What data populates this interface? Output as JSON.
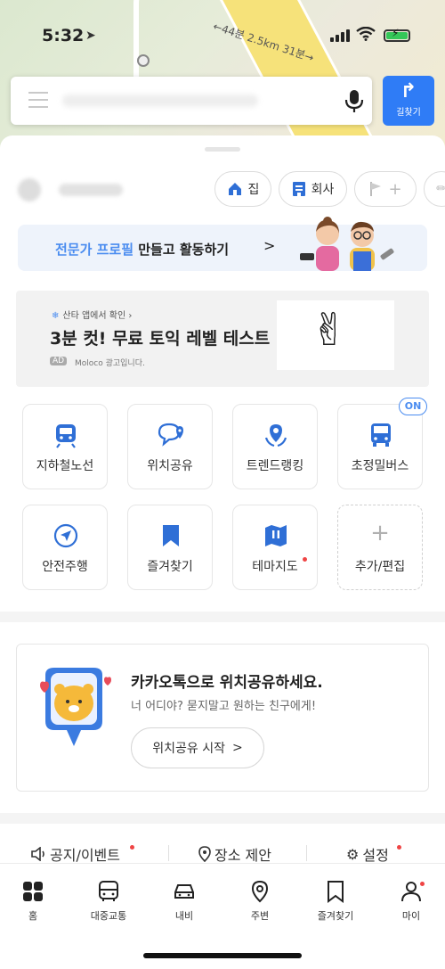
{
  "status_bar": {
    "time": "5:32"
  },
  "map": {
    "distance_label": "←44분 2.5km 31분→"
  },
  "search": {
    "route_button_label": "길찾기"
  },
  "shortcuts": [
    {
      "label": "집",
      "icon": "home-icon"
    },
    {
      "label": "회사",
      "icon": "office-icon"
    },
    {
      "label": "+",
      "icon": "flag-icon"
    }
  ],
  "banner": {
    "highlight": "전문가 프로필",
    "rest": " 만들고 활동하기",
    "chevron": ">"
  },
  "ad": {
    "source": "산타 앱에서 확인 ›",
    "headline": "3분 컷! 무료 토익 레벨 테스트",
    "badge": "AD",
    "advertiser": "Moloco 광고입니다."
  },
  "tiles_row1": [
    {
      "label": "지하철노선",
      "icon": "subway-icon"
    },
    {
      "label": "위치공유",
      "icon": "location-share-icon"
    },
    {
      "label": "트렌드랭킹",
      "icon": "trend-ranking-icon"
    },
    {
      "label": "초정밀버스",
      "icon": "bus-icon",
      "badge": "ON"
    }
  ],
  "tiles_row2": [
    {
      "label": "안전주행",
      "icon": "safe-driving-icon"
    },
    {
      "label": "즐겨찾기",
      "icon": "bookmark-icon"
    },
    {
      "label": "테마지도",
      "icon": "theme-map-icon"
    },
    {
      "label": "추가/편집",
      "icon": "plus-icon"
    }
  ],
  "share_card": {
    "title": "카카오톡으로 위치공유하세요.",
    "subtitle": "너 어디야? 묻지말고 원하는 친구에게!",
    "button": "위치공유 시작",
    "button_chevron": ">"
  },
  "footer_links": [
    {
      "label": "공지/이벤트",
      "icon": "speaker-icon"
    },
    {
      "label": "장소 제안",
      "icon": "pin-icon"
    },
    {
      "label": "설정",
      "icon": "gear-icon"
    }
  ],
  "tabbar": [
    {
      "label": "홈",
      "icon": "home-grid-icon"
    },
    {
      "label": "대중교통",
      "icon": "transit-icon"
    },
    {
      "label": "내비",
      "icon": "car-icon"
    },
    {
      "label": "주변",
      "icon": "nearby-pin-icon"
    },
    {
      "label": "즐겨찾기",
      "icon": "bookmark-icon"
    },
    {
      "label": "마이",
      "icon": "person-icon"
    }
  ],
  "colors": {
    "accent": "#2f7cf6",
    "highlight": "#4a8cf0",
    "alert_dot": "#ef4444"
  }
}
